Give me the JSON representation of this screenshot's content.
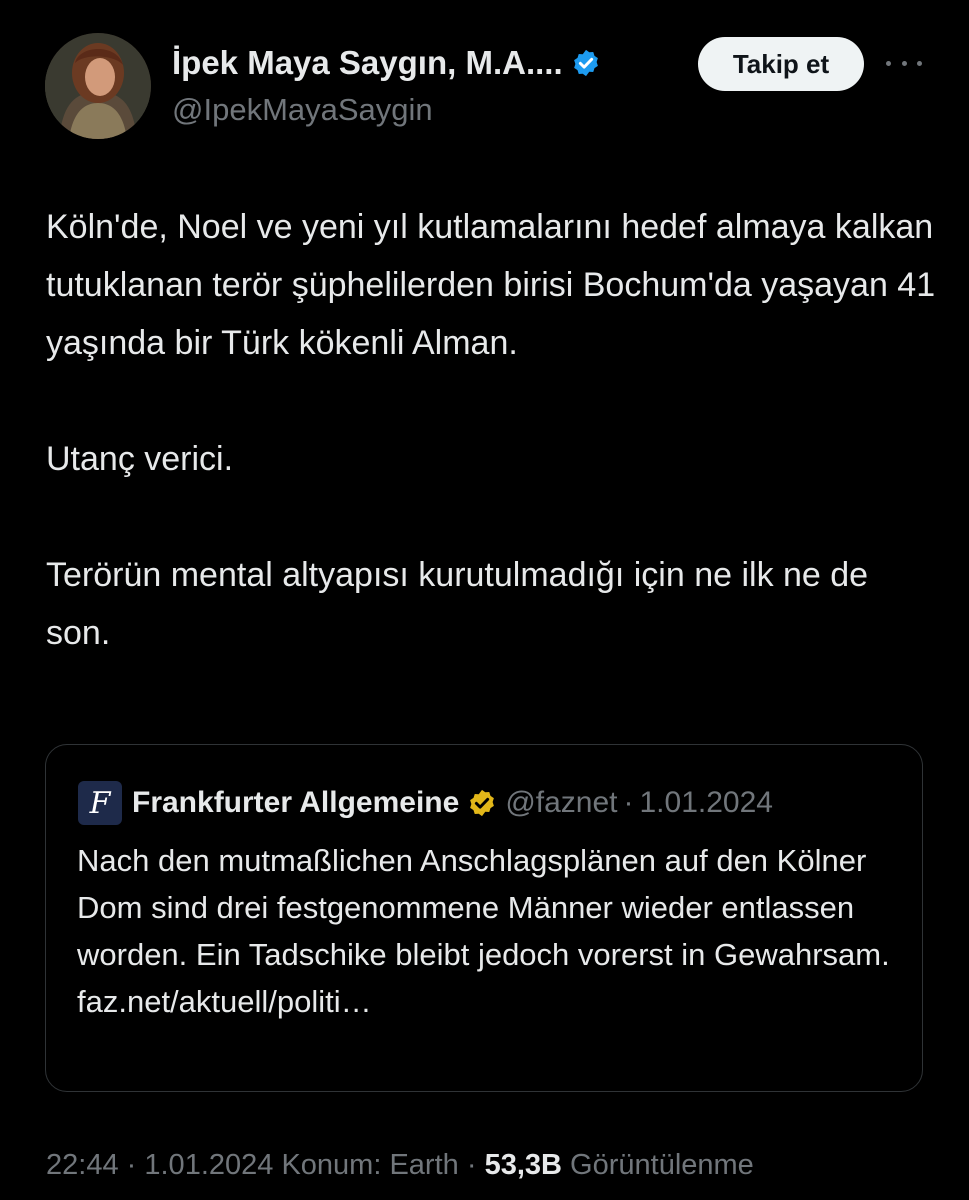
{
  "author": {
    "display_name": "İpek Maya Saygın, M.A....",
    "handle": "@IpekMayaSaygin",
    "verified": true,
    "verified_color": "#1d9bf0"
  },
  "follow_button": {
    "label": "Takip et"
  },
  "more_icon": "more-horizontal-icon",
  "tweet": {
    "paragraphs": [
      "Köln'de, Noel ve yeni yıl kutlamalarını hedef almaya kalkan tutuklanan terör şüphelilerden birisi Bochum'da yaşayan 41 yaşında bir Türk kökenli Alman.",
      "Utanç verici.",
      "Terörün mental altyapısı kurutulmadığı için ne ilk ne de son."
    ]
  },
  "quote": {
    "logo_glyph": "F",
    "name": "Frankfurter Allgemeine",
    "badge_color": "#e2b719",
    "handle": "@faznet",
    "separator": "·",
    "date": "1.01.2024",
    "text": "Nach den mutmaßlichen Anschlagsplänen auf den Kölner Dom sind drei festgenommene Männer wieder entlassen worden. Ein Tadschike bleibt jedoch vorerst in Gewahrsam. faz.net/aktuell/politi…"
  },
  "meta": {
    "time": "22:44",
    "separator": "·",
    "date": "1.01.2024",
    "location": "Konum: Earth",
    "views_count": "53,3B",
    "views_label": "Görüntülenme"
  },
  "colors": {
    "background": "#000000",
    "text_primary": "#e7e9ea",
    "text_secondary": "#71767b",
    "border": "#2f3336"
  }
}
